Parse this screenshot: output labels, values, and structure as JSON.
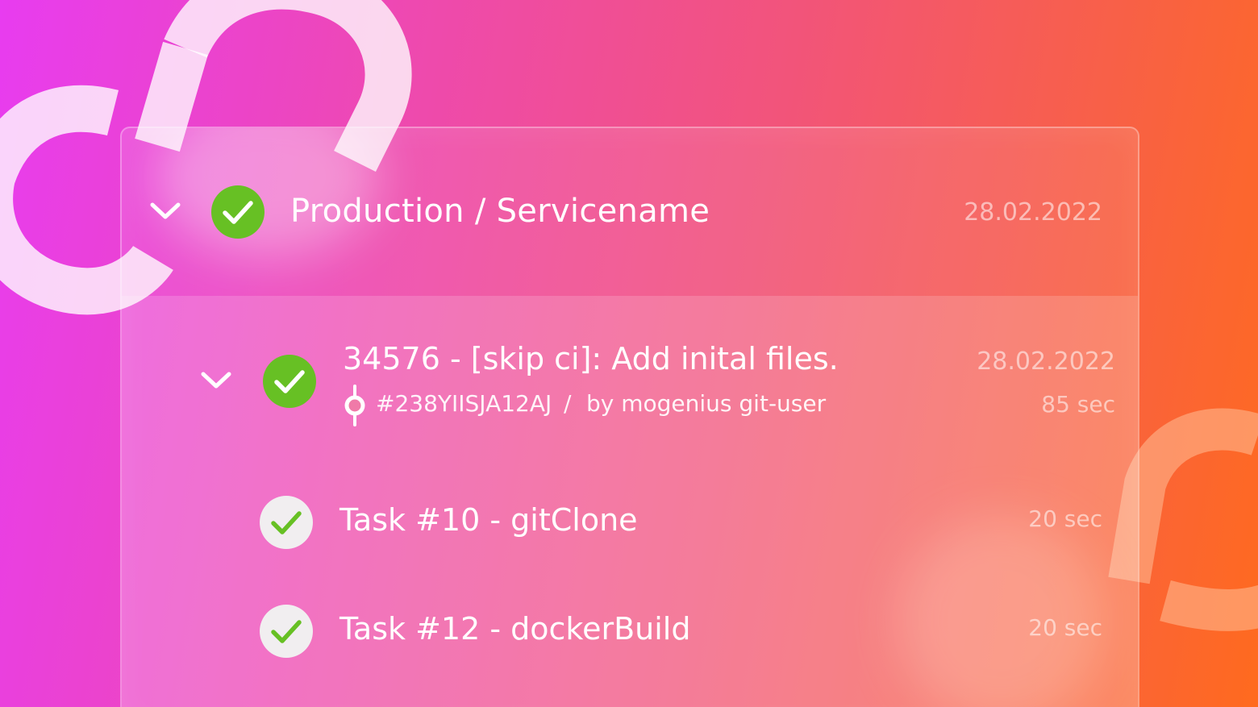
{
  "colors": {
    "success_green": "#67c024",
    "check_light_bg": "#f1eef0",
    "bg_start": "#e83cf0",
    "bg_end": "#ff6a1e"
  },
  "deployment": {
    "title": "Production / Servicename",
    "date": "28.02.2022",
    "status_icon": "check-circle-icon",
    "toggle_icon": "chevron-down-icon"
  },
  "build": {
    "title": "34576 - [skip ci]: Add inital files.",
    "commit_hash": "#238YIISJA12AJ",
    "separator": "/",
    "author": "by mogenius git-user",
    "date": "28.02.2022",
    "duration": "85 sec",
    "commit_icon": "git-commit-icon"
  },
  "tasks": [
    {
      "label": "Task #10 - gitClone",
      "duration": "20 sec"
    },
    {
      "label": "Task #12 - dockerBuild",
      "duration": "20 sec"
    }
  ]
}
